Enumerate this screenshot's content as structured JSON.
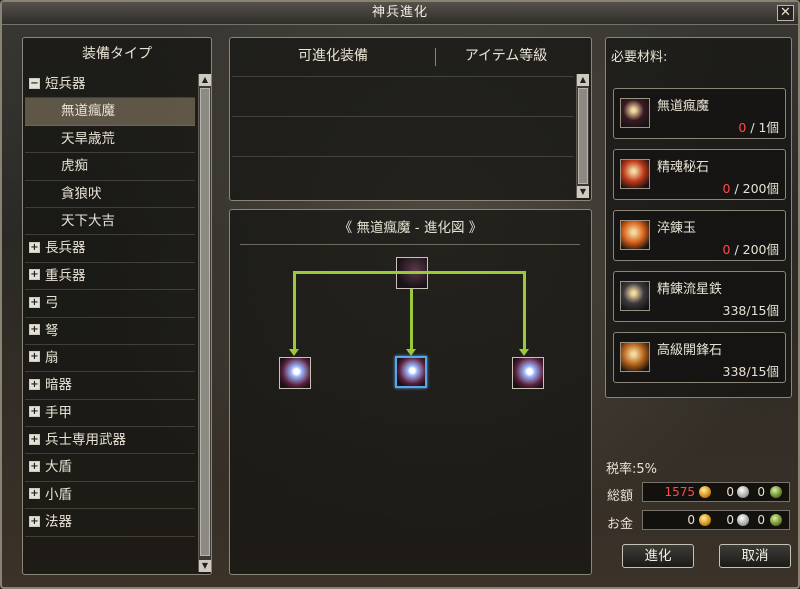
{
  "window": {
    "title": "神兵進化",
    "close_label": "✕"
  },
  "tree": {
    "header": "装備タイプ",
    "items": [
      {
        "label": "短兵器",
        "type": "category",
        "expanded": true
      },
      {
        "label": "無道瘋魔",
        "type": "sub",
        "selected": true
      },
      {
        "label": "天旱歳荒",
        "type": "sub"
      },
      {
        "label": "虎痴",
        "type": "sub"
      },
      {
        "label": "貪狼吠",
        "type": "sub"
      },
      {
        "label": "天下大吉",
        "type": "sub"
      },
      {
        "label": "長兵器",
        "type": "category"
      },
      {
        "label": "重兵器",
        "type": "category"
      },
      {
        "label": "弓",
        "type": "category"
      },
      {
        "label": "弩",
        "type": "category"
      },
      {
        "label": "扇",
        "type": "category"
      },
      {
        "label": "暗器",
        "type": "category"
      },
      {
        "label": "手甲",
        "type": "category"
      },
      {
        "label": "兵士専用武器",
        "type": "category"
      },
      {
        "label": "大盾",
        "type": "category"
      },
      {
        "label": "小盾",
        "type": "category"
      },
      {
        "label": "法器",
        "type": "category"
      }
    ]
  },
  "equip_list": {
    "col_equipment": "可進化装備",
    "col_grade": "アイテム等級"
  },
  "evolution": {
    "title": "《 無道瘋魔 - 進化図 》",
    "root_icon": "sword-icon",
    "children": [
      "glowing-sword-icon",
      "glowing-sword-icon",
      "glowing-sword-icon"
    ],
    "selected_child": 1,
    "line_color": "#9cc93a"
  },
  "materials": {
    "label": "必要材料:",
    "items": [
      {
        "name": "無道瘋魔",
        "have": "0",
        "need": " / 1個",
        "insufficient": true,
        "icon": "sword-icon",
        "color": "#3a1a22"
      },
      {
        "name": "精魂秘石",
        "have": "0",
        "need": " / 200個",
        "insufficient": true,
        "icon": "red-stone-icon",
        "color": "#c0391a"
      },
      {
        "name": "淬錬玉",
        "have": "0",
        "need": " / 200個",
        "insufficient": true,
        "icon": "orange-orb-icon",
        "color": "#d9621a"
      },
      {
        "name": "精錬流星鉄",
        "have": "338",
        "need": "/15個",
        "insufficient": false,
        "icon": "meteor-iron-icon",
        "color": "#3d3a3f"
      },
      {
        "name": "高級開鋒石",
        "have": "338",
        "need": "/15個",
        "insufficient": false,
        "icon": "whetstone-icon",
        "color": "#b8641a"
      }
    ]
  },
  "footer": {
    "tax_label": "税率:5%",
    "total_label": "総額",
    "total": {
      "gold": "1575",
      "silver": "0",
      "copper": "0"
    },
    "money_label": "お金",
    "money": {
      "gold": "0",
      "silver": "0",
      "copper": "0"
    },
    "total_gold_color": "#ff4a4a"
  },
  "buttons": {
    "evolve": "進化",
    "cancel": "取消"
  }
}
